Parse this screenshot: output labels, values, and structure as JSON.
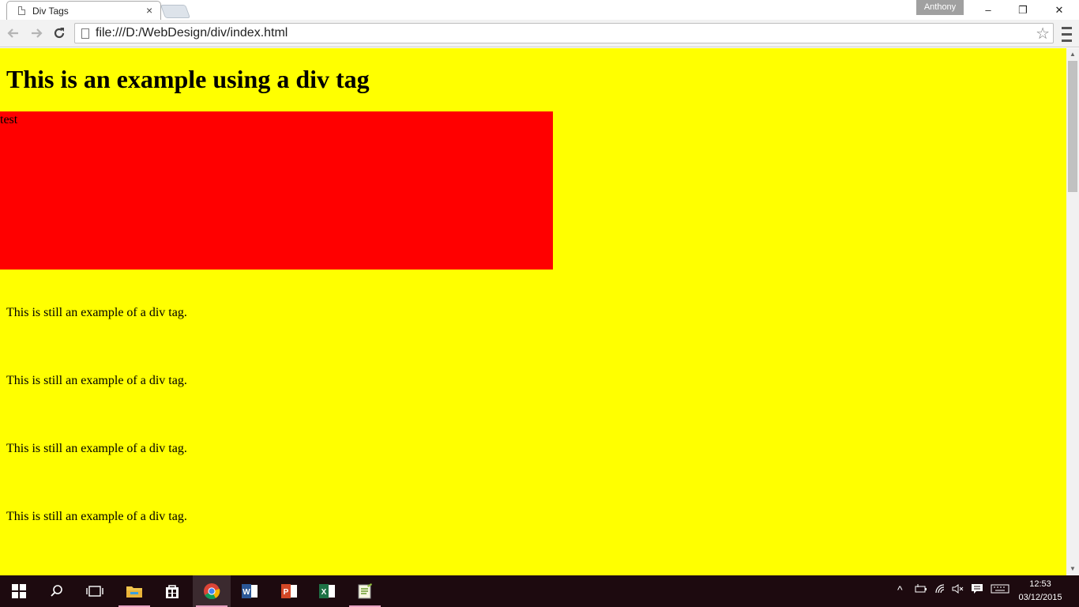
{
  "browser": {
    "tab_title": "Div Tags",
    "tab_close": "×",
    "profile_name": "Anthony",
    "url": "file:///D:/WebDesign/div/index.html",
    "window_controls": {
      "minimize": "–",
      "restore": "❐",
      "close": "✕"
    }
  },
  "page": {
    "heading": "This is an example using a div tag",
    "box_text": "test",
    "paragraphs": [
      "This is still an example of a div tag.",
      "This is still an example of a div tag.",
      "This is still an example of a div tag.",
      "This is still an example of a div tag."
    ],
    "background_color": "#ffff00",
    "box_color": "#ff0000"
  },
  "taskbar": {
    "apps": [
      "start-icon",
      "search-icon",
      "task-view-icon",
      "file-explorer-icon",
      "store-icon",
      "chrome-icon",
      "word-icon",
      "powerpoint-icon",
      "excel-icon",
      "notepad-plus-icon"
    ],
    "clock_time": "12:53",
    "clock_date": "03/12/2015"
  }
}
